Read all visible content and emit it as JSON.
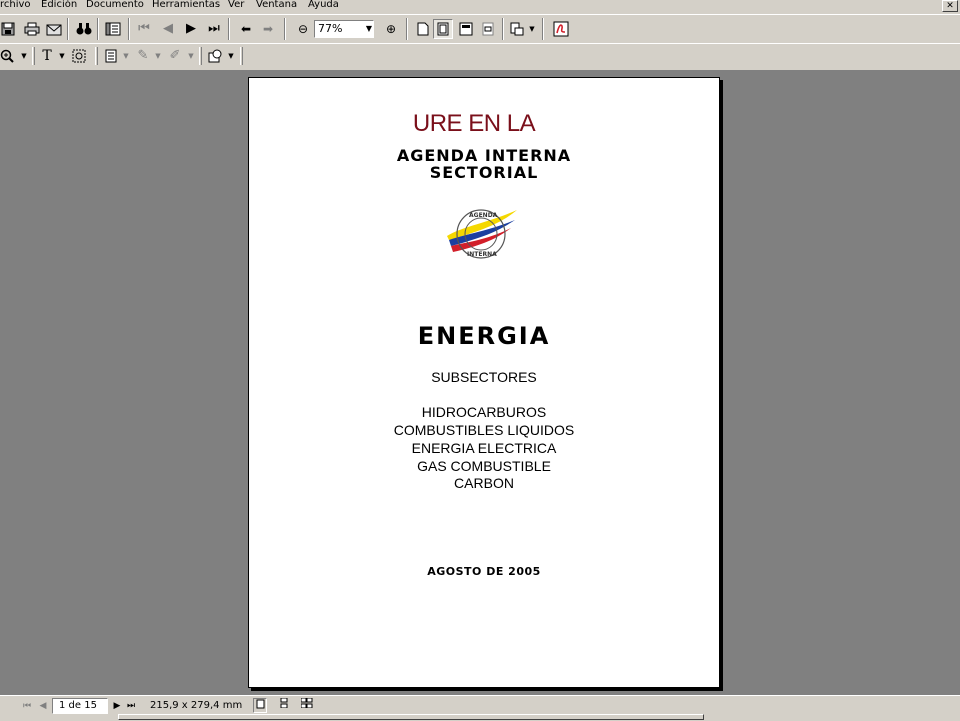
{
  "menu": {
    "items": [
      "rchivo",
      "Edición",
      "Documento",
      "Herramientas",
      "Ver",
      "Ventana",
      "Ayuda"
    ]
  },
  "toolbar": {
    "zoom_value": "77%"
  },
  "document": {
    "title_line1": "URE EN LA",
    "title_line2": "AGENDA INTERNA",
    "title_line3": "SECTORIAL",
    "logo": {
      "top_text": "AGENDA",
      "bottom_text": "INTERNA",
      "colors": {
        "yellow": "#f5d800",
        "blue": "#1b3fa0",
        "red": "#d21f2a"
      }
    },
    "heading": "ENERGIA",
    "subsectors_label": "SUBSECTORES",
    "subsectors": [
      "HIDROCARBUROS",
      "COMBUSTIBLES LIQUIDOS",
      "ENERGIA ELECTRICA",
      "GAS COMBUSTIBLE",
      "CARBON"
    ],
    "date": "AGOSTO DE 2005"
  },
  "status": {
    "page_indicator": "1 de 15",
    "page_size": "215,9 x 279,4  mm"
  },
  "colors": {
    "title_red": "#7a0f1a",
    "viewer_bg": "#808080",
    "chrome": "#d4d0c8"
  }
}
